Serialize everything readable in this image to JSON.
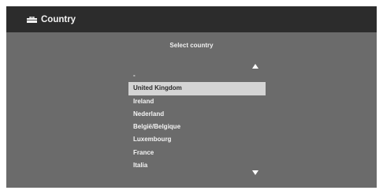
{
  "header": {
    "icon": "toolbox-icon",
    "title": "Country"
  },
  "dialog": {
    "subtitle": "Select country"
  },
  "country_list": {
    "scroll_up_icon": "triangle-up-icon",
    "scroll_down_icon": "triangle-down-icon",
    "selected_index": 1,
    "items": [
      "-",
      "United Kingdom",
      "Ireland",
      "Nederland",
      "België/Belgique",
      "Luxembourg",
      "France",
      "Italia"
    ]
  },
  "colors": {
    "header_bg": "#2c2c2c",
    "panel_bg": "#6b6b6b",
    "selection_bg": "#d4d4d4",
    "text": "#f4f4f4"
  }
}
